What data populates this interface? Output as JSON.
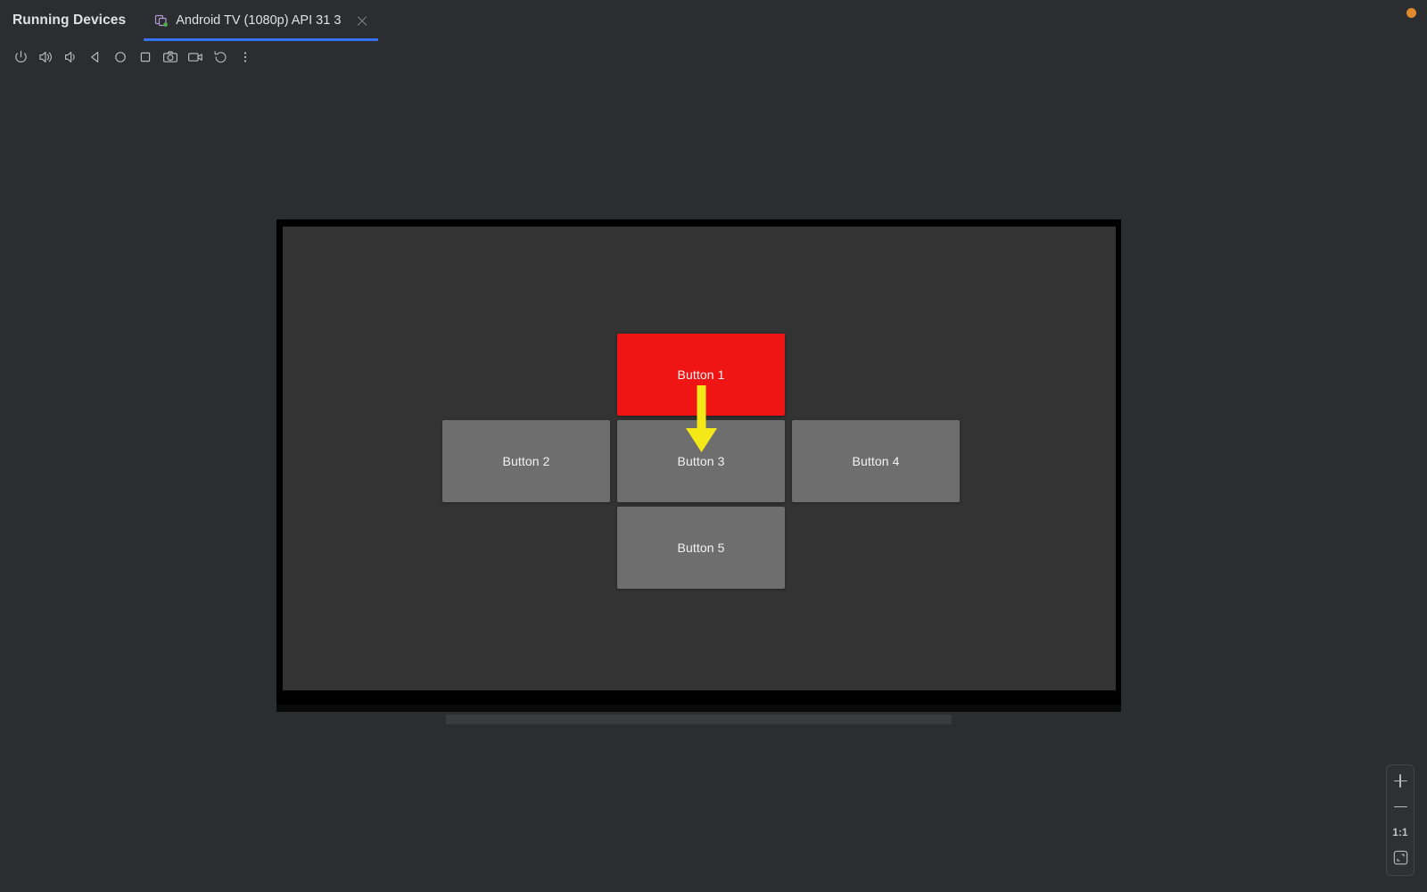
{
  "window": {
    "panel_title": "Running Devices",
    "warning_indicator": "warning-dot"
  },
  "tabs": [
    {
      "label": "Android TV (1080p) API 31 3",
      "icon": "device-icon",
      "active": true,
      "close_label": "×"
    }
  ],
  "toolbar": {
    "buttons": [
      {
        "name": "power-button",
        "icon": "power-icon",
        "tooltip": "Power"
      },
      {
        "name": "volume-up-button",
        "icon": "volume-up-icon",
        "tooltip": "Volume Up"
      },
      {
        "name": "volume-down-button",
        "icon": "volume-down-icon",
        "tooltip": "Volume Down"
      },
      {
        "name": "back-button",
        "icon": "back-triangle-icon",
        "tooltip": "Back"
      },
      {
        "name": "home-button",
        "icon": "home-circle-icon",
        "tooltip": "Home"
      },
      {
        "name": "overview-button",
        "icon": "overview-square-icon",
        "tooltip": "Overview"
      },
      {
        "name": "screenshot-button",
        "icon": "camera-icon",
        "tooltip": "Take Screenshot"
      },
      {
        "name": "record-button",
        "icon": "video-camera-icon",
        "tooltip": "Record Screen"
      },
      {
        "name": "rotate-button",
        "icon": "rotate-left-icon",
        "tooltip": "Rotate Left"
      },
      {
        "name": "more-options-button",
        "icon": "kebab-menu-icon",
        "tooltip": "More"
      }
    ]
  },
  "device": {
    "form_factor": "tv",
    "screen_background": "#333333",
    "bezel_color": "#000000"
  },
  "app_screen": {
    "buttons": [
      {
        "label": "Button 1",
        "state": "focused",
        "color": "#f01515",
        "position": "top-center"
      },
      {
        "label": "Button 2",
        "state": "normal",
        "color": "#6e6e6e",
        "position": "middle-left"
      },
      {
        "label": "Button 3",
        "state": "normal",
        "color": "#6e6e6e",
        "position": "middle-center"
      },
      {
        "label": "Button 4",
        "state": "normal",
        "color": "#6e6e6e",
        "position": "middle-right"
      },
      {
        "label": "Button 5",
        "state": "normal",
        "color": "#6e6e6e",
        "position": "bottom-center"
      }
    ],
    "annotation": {
      "type": "arrow",
      "color": "#f5e818",
      "direction": "down",
      "from": "Button 1",
      "to": "Button 3"
    }
  },
  "zoom_controls": {
    "zoom_in_label": "+",
    "zoom_out_label": "−",
    "actual_size_label": "1:1",
    "fit_label": "fit-to-screen-icon"
  }
}
